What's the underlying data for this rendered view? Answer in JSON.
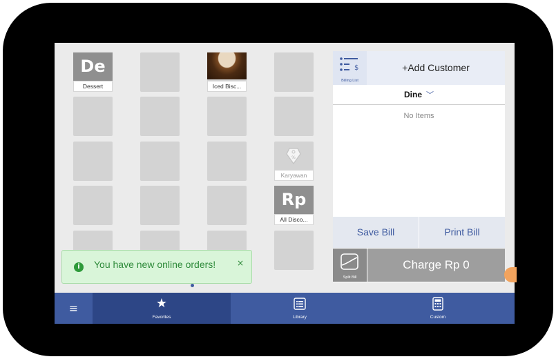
{
  "tiles": {
    "dessert": {
      "abbr": "De",
      "label": "Dessert"
    },
    "iced": {
      "label": "Iced Bisc..."
    },
    "karyawan": {
      "label": "Karyawan"
    },
    "discount": {
      "abbr": "Rp",
      "label": "All Disco..."
    }
  },
  "order_panel": {
    "billing_list_label": "Billing List",
    "add_customer": "+Add Customer",
    "dine_option": "Dine",
    "empty_text": "No Items",
    "save_bill": "Save Bill",
    "print_bill": "Print Bill",
    "split_bill_label": "Split Bill",
    "charge": "Charge Rp 0"
  },
  "toast": {
    "message": "You have new online orders!",
    "close": "×",
    "icon": "i"
  },
  "nav": {
    "menu_icon": "≡",
    "tabs": [
      {
        "label": "Favorites",
        "icon": "star-icon",
        "active": true
      },
      {
        "label": "Library",
        "icon": "list-icon",
        "active": false
      },
      {
        "label": "Custom",
        "icon": "calculator-icon",
        "active": false
      }
    ]
  },
  "colors": {
    "accent": "#3f5ba0",
    "active_tab": "#2d4686",
    "toast_bg": "#d9f5d9",
    "toast_text": "#2e8a3a",
    "tile": "#d3d3d3"
  }
}
